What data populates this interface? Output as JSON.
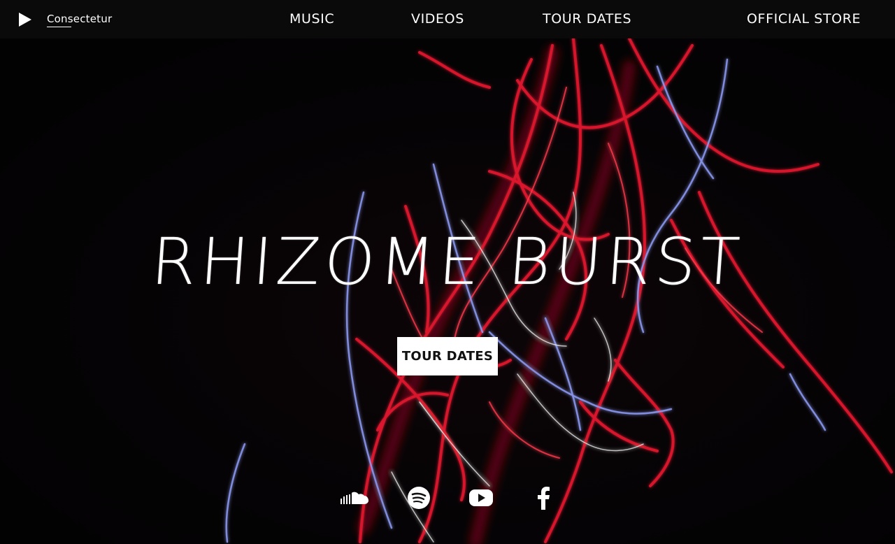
{
  "header": {
    "play_icon": "play-icon",
    "brand": "Consectetur",
    "nav": [
      "MUSIC",
      "VIDEOS",
      "TOUR DATES",
      "OFFICIAL STORE"
    ]
  },
  "hero": {
    "title": "RHIZOME BURST",
    "cta_label": "TOUR DATES"
  },
  "social": [
    "soundcloud-icon",
    "spotify-icon",
    "youtube-icon",
    "facebook-icon"
  ],
  "colors": {
    "background": "#040404",
    "topbar": "#0a0a0a",
    "light_red": "#e0192e",
    "light_blue": "#8f9cf5",
    "cta_bg": "#ffffff"
  }
}
